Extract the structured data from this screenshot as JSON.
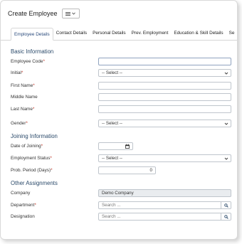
{
  "header": {
    "title": "Create Employee",
    "menu_icon": "list-icon"
  },
  "tabs": [
    {
      "label": "Employee Details",
      "active": true
    },
    {
      "label": "Contact Details"
    },
    {
      "label": "Personal Details"
    },
    {
      "label": "Prev. Employment"
    },
    {
      "label": "Education & Skill Details"
    },
    {
      "label": "Se"
    }
  ],
  "sections": {
    "basic": "Basic Information",
    "joining": "Joining Information",
    "other": "Other Assignments"
  },
  "required_mark": "*",
  "fields": {
    "employee_code": {
      "label": "Employee Code",
      "value": ""
    },
    "initial": {
      "label": "Initial",
      "value": "-- Select --"
    },
    "first_name": {
      "label": "First Name",
      "value": ""
    },
    "middle_name": {
      "label": "Middle Name",
      "value": ""
    },
    "last_name": {
      "label": "Last Name",
      "value": ""
    },
    "gender": {
      "label": "Gender",
      "value": "-- Select --"
    },
    "date_of_joining": {
      "label": "Date of Joining",
      "value": ""
    },
    "employment_status": {
      "label": "Employment Status",
      "value": "-- Select --"
    },
    "prob_period": {
      "label": "Prob. Period (Days)",
      "value": "0"
    },
    "company": {
      "label": "Company",
      "value": "Demo Company"
    },
    "department": {
      "label": "Department",
      "placeholder": "Search ..."
    },
    "designation": {
      "label": "Designation",
      "placeholder": "Search ..."
    }
  }
}
